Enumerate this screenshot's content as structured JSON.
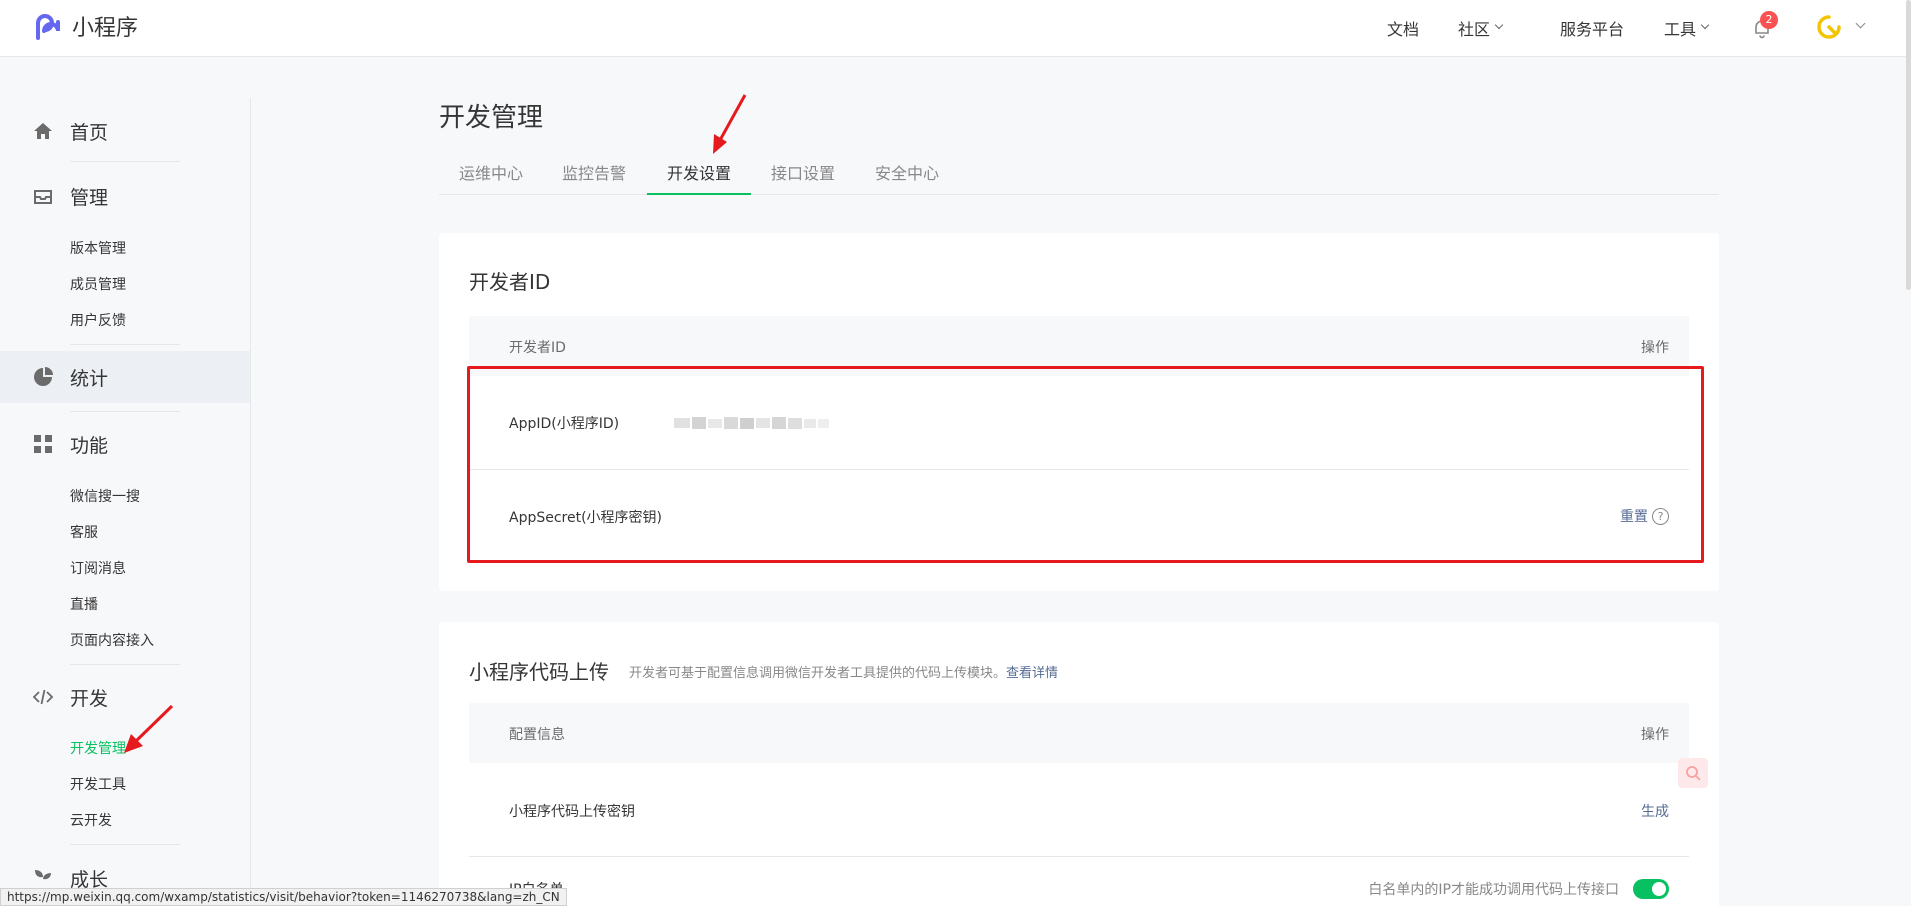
{
  "header": {
    "logo_text": "小程序",
    "nav": [
      {
        "label": "文档",
        "has_dropdown": false
      },
      {
        "label": "社区",
        "has_dropdown": true
      },
      {
        "label": "服务平台",
        "has_dropdown": false
      },
      {
        "label": "工具",
        "has_dropdown": true
      }
    ],
    "notification_count": "2",
    "brand_color": "#07c160"
  },
  "sidebar": {
    "sections": [
      {
        "label": "首页",
        "icon": "home-icon"
      },
      {
        "label": "管理",
        "icon": "inbox-icon",
        "items": [
          "版本管理",
          "成员管理",
          "用户反馈"
        ]
      },
      {
        "label": "统计",
        "icon": "pie-chart-icon"
      },
      {
        "label": "功能",
        "icon": "grid-icon",
        "items": [
          "微信搜一搜",
          "客服",
          "订阅消息",
          "直播",
          "页面内容接入"
        ]
      },
      {
        "label": "开发",
        "icon": "code-icon",
        "items": [
          "开发管理",
          "开发工具",
          "云开发"
        ]
      },
      {
        "label": "成长",
        "icon": "leaf-icon"
      }
    ],
    "active_item": "开发管理",
    "hover_section": "统计"
  },
  "main": {
    "title": "开发管理",
    "tabs": [
      "运维中心",
      "监控告警",
      "开发设置",
      "接口设置",
      "安全中心"
    ],
    "active_tab": "开发设置",
    "developer_id_card": {
      "title": "开发者ID",
      "col_left": "开发者ID",
      "col_right": "操作",
      "rows": [
        {
          "label": "AppID(小程序ID)",
          "value_state": "blurred",
          "action": ""
        },
        {
          "label": "AppSecret(小程序密钥)",
          "action": "重置"
        }
      ],
      "help_icon": "?"
    },
    "upload_card": {
      "title": "小程序代码上传",
      "desc": "开发者可基于配置信息调用微信开发者工具提供的代码上传模块。",
      "desc_link": "查看详情",
      "col_left": "配置信息",
      "col_right": "操作",
      "rows": [
        {
          "label": "小程序代码上传密钥",
          "action": "生成"
        },
        {
          "label": "IP白名单",
          "hint": "白名单内的IP才能成功调用代码上传接口",
          "toggle_on": true
        }
      ]
    }
  },
  "status_bar": {
    "url": "https://mp.weixin.qq.com/wxamp/statistics/visit/behavior?token=1146270738&lang=zh_CN"
  },
  "annotations": {
    "highlight_color": "#e6191c"
  }
}
